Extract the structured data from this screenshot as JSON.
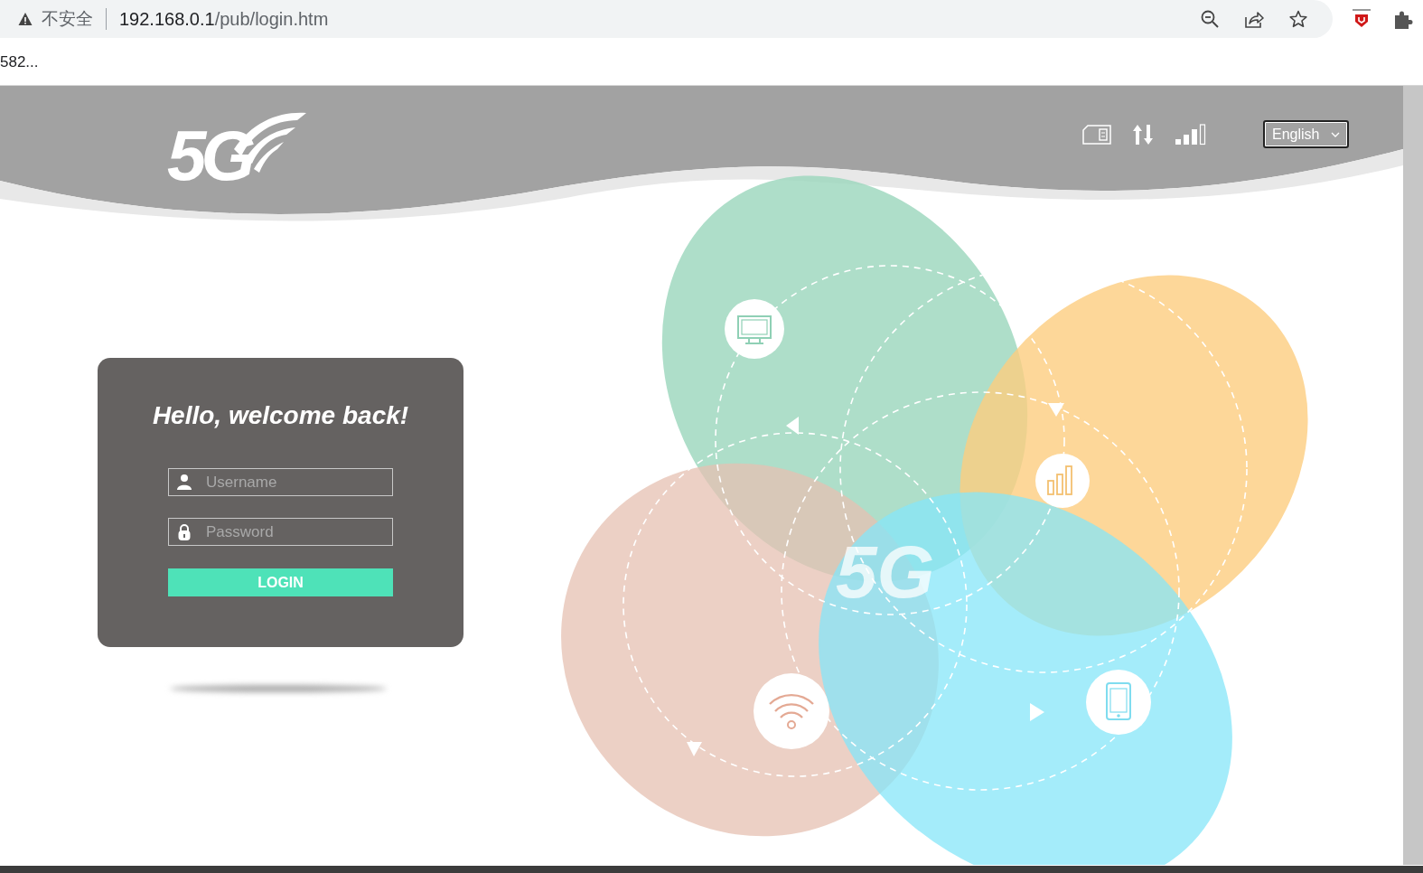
{
  "browser": {
    "security_label": "不安全",
    "url_host": "192.168.0.1",
    "url_path": "/pub/login.htm"
  },
  "bookmark_bar": {
    "item": "582..."
  },
  "header": {
    "logo": "5G",
    "language": "English"
  },
  "login": {
    "title": "Hello, welcome back!",
    "username_placeholder": "Username",
    "password_placeholder": "Password",
    "button": "LOGIN"
  },
  "illustration": {
    "label": "5G"
  }
}
